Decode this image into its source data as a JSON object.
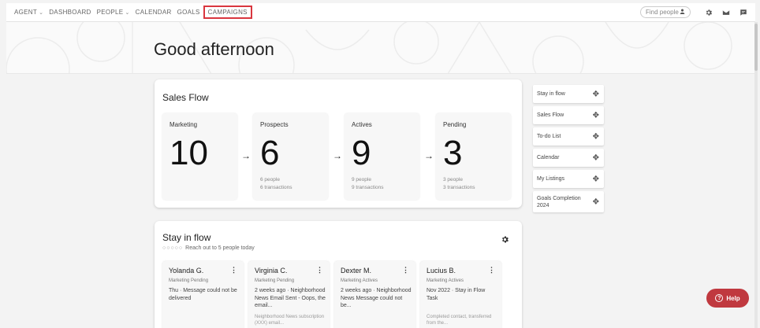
{
  "nav": {
    "items": [
      {
        "label": "AGENT",
        "chevron": true
      },
      {
        "label": "DASHBOARD",
        "chevron": false
      },
      {
        "label": "PEOPLE",
        "chevron": true
      },
      {
        "label": "CALENDAR",
        "chevron": false
      },
      {
        "label": "GOALS",
        "chevron": false
      },
      {
        "label": "CAMPAIGNS",
        "chevron": false,
        "highlighted": true
      }
    ],
    "find_people_placeholder": "Find people",
    "icons": [
      "user-icon",
      "gear-icon",
      "mail-icon",
      "chat-icon"
    ]
  },
  "hero": {
    "greeting": "Good afternoon"
  },
  "sales_flow": {
    "title": "Sales Flow",
    "stages": [
      {
        "label": "Marketing",
        "count": "10",
        "people": "",
        "transactions": ""
      },
      {
        "label": "Prospects",
        "count": "6",
        "people": "6 people",
        "transactions": "6 transactions"
      },
      {
        "label": "Actives",
        "count": "9",
        "people": "9 people",
        "transactions": "9 transactions"
      },
      {
        "label": "Pending",
        "count": "3",
        "people": "3 people",
        "transactions": "3 transactions"
      }
    ],
    "arrow": "→"
  },
  "stay_in_flow": {
    "title": "Stay in flow",
    "dots": "○○○○○",
    "subtitle": "Reach out to 5 people today",
    "people": [
      {
        "name": "Yolanda G.",
        "stage": "Marketing Pending",
        "message": "Thu · Message could not be delivered",
        "extra": ""
      },
      {
        "name": "Virginia C.",
        "stage": "Marketing Pending",
        "message": "2 weeks ago · Neighborhood News Email Sent - Oops, the email...",
        "extra": "Neighborhood News subscription (XXX) email..."
      },
      {
        "name": "Dexter M.",
        "stage": "Marketing Actives",
        "message": "2 weeks ago · Neighborhood News Message could not be...",
        "extra": ""
      },
      {
        "name": "Lucius B.",
        "stage": "Marketing Actives",
        "message": "Nov 2022 · Stay in Flow Task",
        "extra": "Completed contact, transferred from the..."
      }
    ]
  },
  "widgets": [
    {
      "label": "Stay in flow"
    },
    {
      "label": "Sales Flow"
    },
    {
      "label": "To-do List"
    },
    {
      "label": "Calendar"
    },
    {
      "label": "My Listings"
    },
    {
      "label": "Goals Completion 2024",
      "tall": true
    }
  ],
  "help": {
    "label": "Help"
  },
  "colors": {
    "accent": "#c0393f",
    "highlight_border": "#d9363e"
  }
}
